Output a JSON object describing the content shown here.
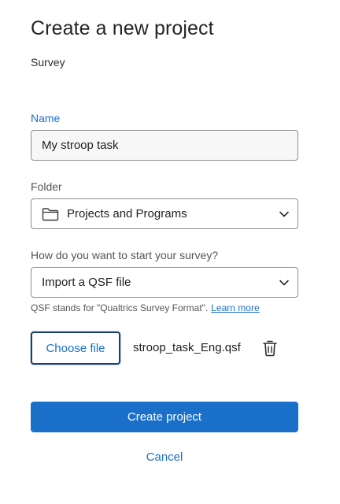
{
  "header": {
    "title": "Create a new project",
    "subtitle": "Survey"
  },
  "form": {
    "name": {
      "label": "Name",
      "value": "My stroop task"
    },
    "folder": {
      "label": "Folder",
      "selected": "Projects and Programs",
      "icon": "folder-icon"
    },
    "start": {
      "label": "How do you want to start your survey?",
      "selected": "Import a QSF file"
    },
    "hint": {
      "text": "QSF stands for \"Qualtrics Survey Format\".",
      "link": "Learn more"
    },
    "file": {
      "choose_label": "Choose file",
      "filename": "stroop_task_Eng.qsf",
      "delete_icon": "trash-icon"
    }
  },
  "actions": {
    "create_label": "Create project",
    "cancel_label": "Cancel"
  },
  "colors": {
    "accent": "#1a6fc9",
    "focus_border": "#1a3e6e",
    "field_border": "#8c8c8c",
    "label_text": "#555555"
  }
}
